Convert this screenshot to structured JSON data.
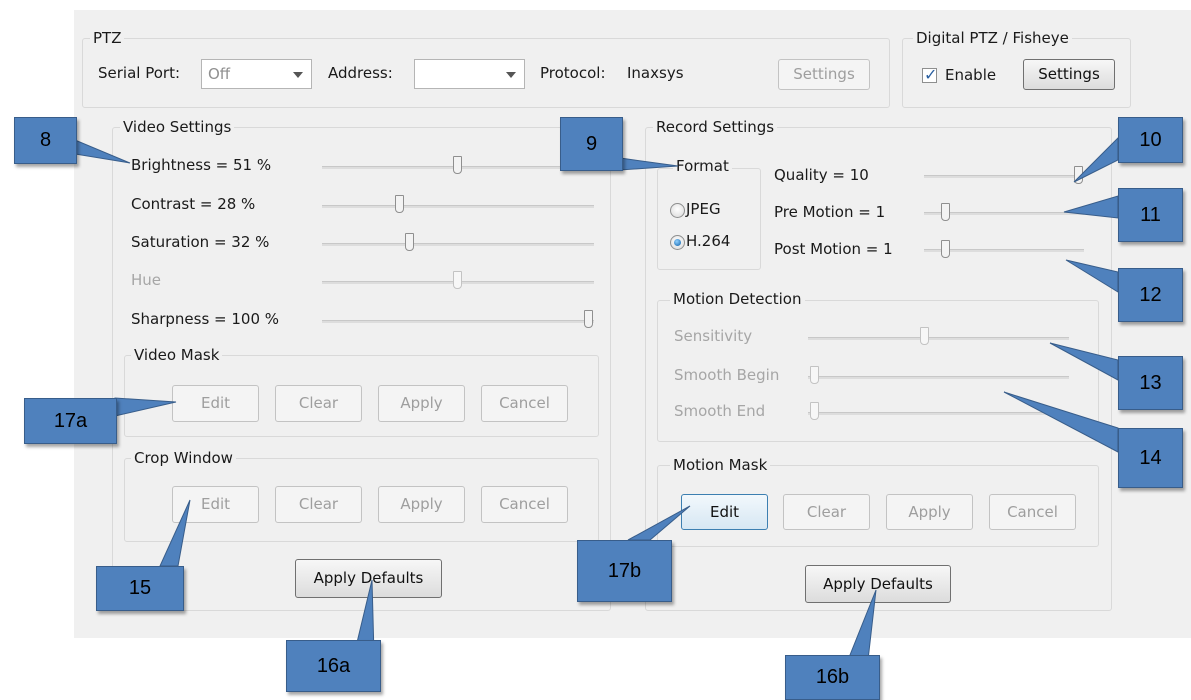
{
  "ptz": {
    "group_label": "PTZ",
    "serial_port_label": "Serial Port:",
    "serial_port_value": "Off",
    "address_label": "Address:",
    "address_value": "",
    "protocol_label": "Protocol:",
    "protocol_value": "Inaxsys",
    "settings_button": "Settings"
  },
  "digital_ptz": {
    "group_label": "Digital PTZ / Fisheye",
    "enable_label": "Enable",
    "enable_checked": true,
    "settings_button": "Settings"
  },
  "video_settings": {
    "group_label": "Video Settings",
    "sliders": [
      {
        "label": "Brightness = 51 %",
        "value": 51,
        "enabled": true
      },
      {
        "label": "Contrast = 28 %",
        "value": 28,
        "enabled": true
      },
      {
        "label": "Saturation = 32 %",
        "value": 32,
        "enabled": true
      },
      {
        "label": "Hue",
        "value": 50,
        "enabled": false
      },
      {
        "label": "Sharpness = 100 %",
        "value": 100,
        "enabled": true
      }
    ],
    "video_mask": {
      "group_label": "Video Mask",
      "edit": "Edit",
      "clear": "Clear",
      "apply": "Apply",
      "cancel": "Cancel"
    },
    "crop_window": {
      "group_label": "Crop Window",
      "edit": "Edit",
      "clear": "Clear",
      "apply": "Apply",
      "cancel": "Cancel"
    },
    "apply_defaults": "Apply Defaults"
  },
  "record_settings": {
    "group_label": "Record Settings",
    "format": {
      "group_label": "Format",
      "options": [
        "JPEG",
        "H.264"
      ],
      "selected": "H.264"
    },
    "quality_label": "Quality = 10",
    "pre_motion_label": "Pre Motion = 1",
    "post_motion_label": "Post Motion = 1",
    "motion_detection": {
      "group_label": "Motion Detection",
      "sensitivity_label": "Sensitivity",
      "smooth_begin_label": "Smooth Begin",
      "smooth_end_label": "Smooth End"
    },
    "motion_mask": {
      "group_label": "Motion Mask",
      "edit": "Edit",
      "clear": "Clear",
      "apply": "Apply",
      "cancel": "Cancel"
    },
    "apply_defaults": "Apply Defaults"
  },
  "callouts": [
    "8",
    "9",
    "10",
    "11",
    "12",
    "13",
    "14",
    "15",
    "16a",
    "16b",
    "17a",
    "17b"
  ],
  "colors": {
    "callout_fill": "#4f81bd",
    "callout_border": "#385d8a",
    "panel_bg": "#f0f0f0",
    "focus_border": "#3c7fb1"
  }
}
